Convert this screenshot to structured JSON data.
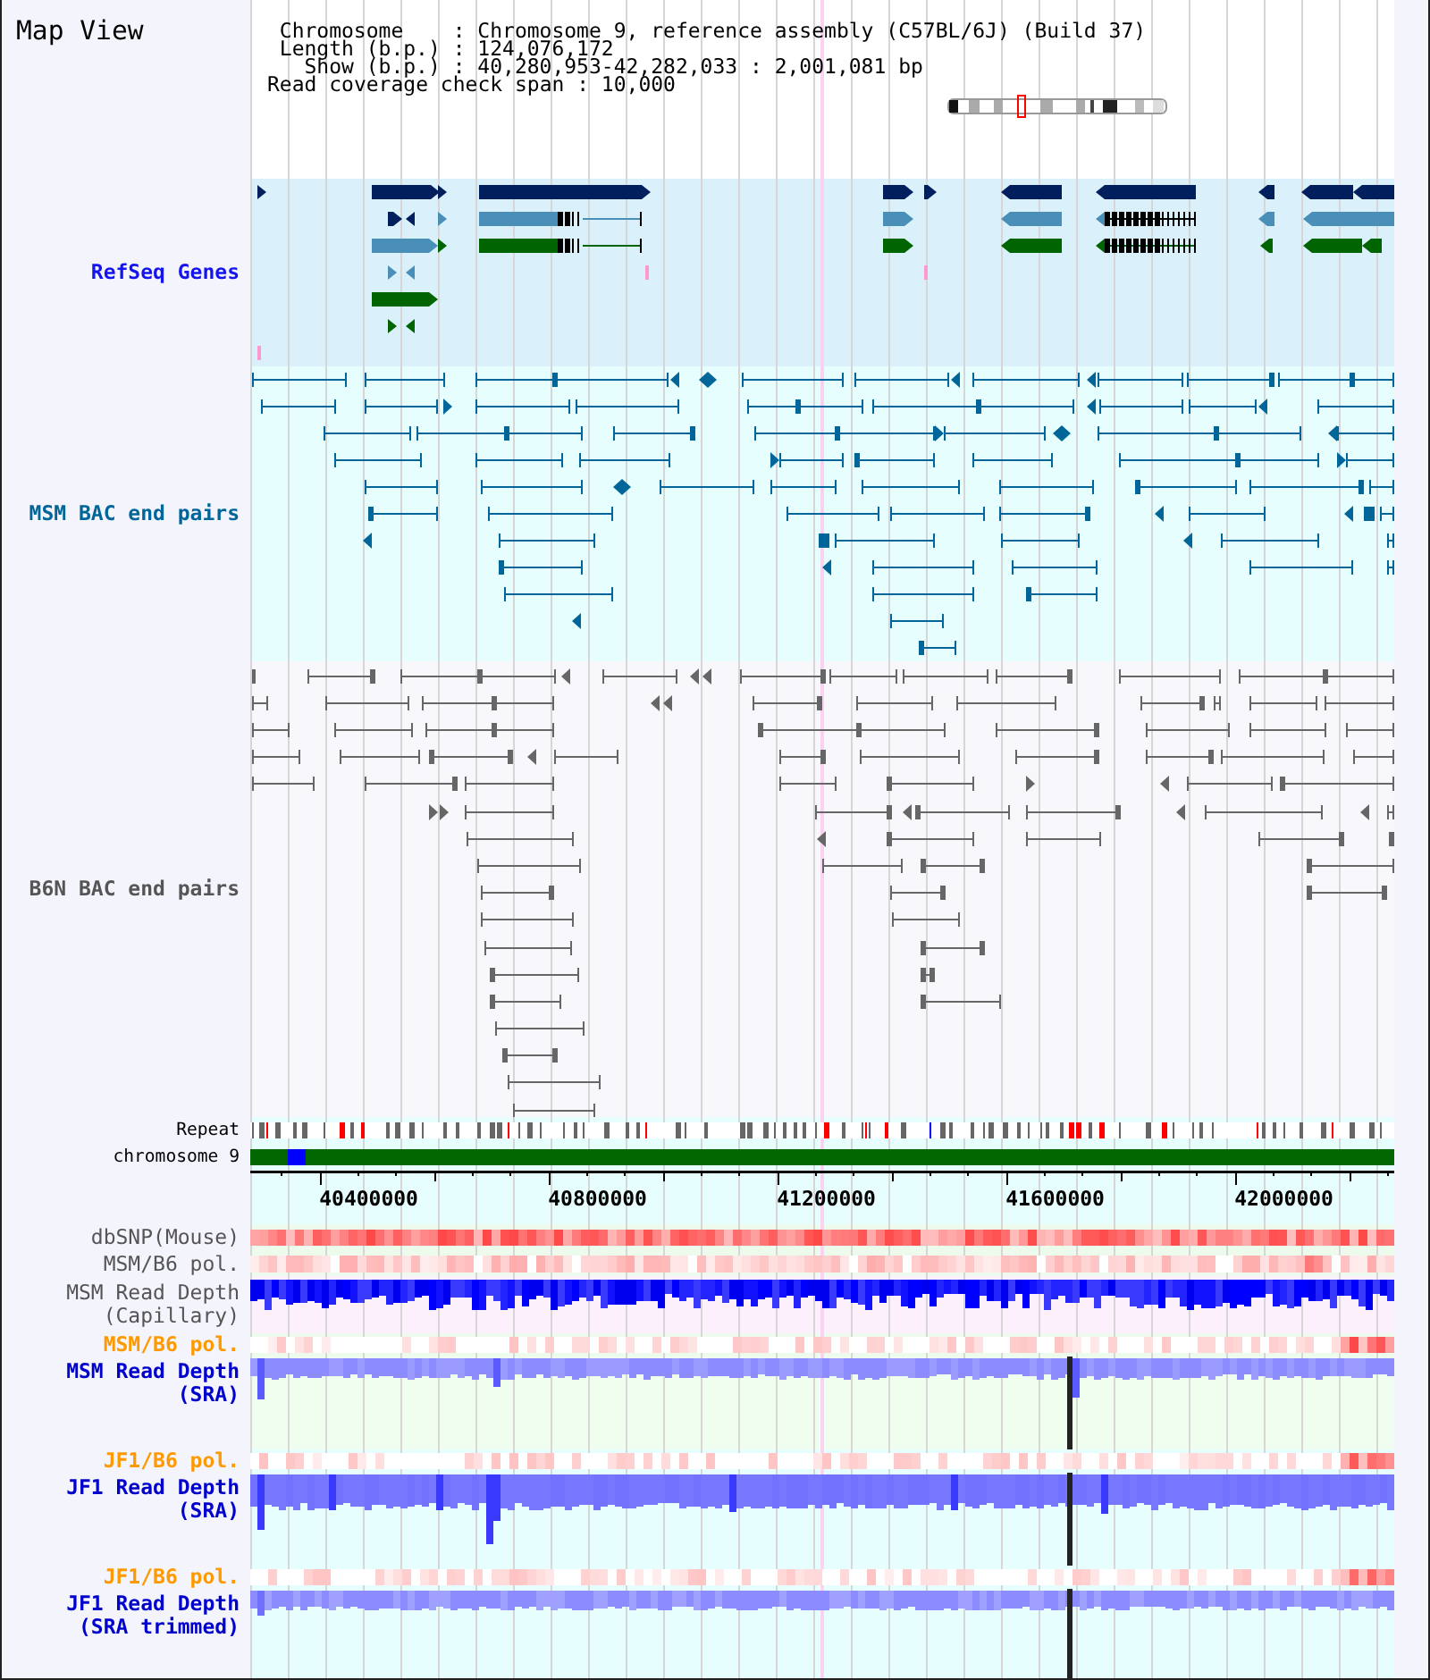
{
  "view": {
    "title": "Map View",
    "info_lines": [
      "Chromosome    : Chromosome 9, reference assembly (C57BL/6J) (Build 37)",
      "Length (b.p.) : 124,076,172",
      "  Show (b.p.) : 40,280,953-42,282,033 : 2,001,081 bp"
    ],
    "coverage_line": "Read coverage check span : 10,000"
  },
  "tracks": [
    {
      "kind": "genes",
      "label": "RefSeq Genes",
      "color": "#1414ee"
    },
    {
      "kind": "bac_pairs",
      "label": "MSM BAC end pairs",
      "color": "#006699"
    },
    {
      "kind": "bac_pairs",
      "label": "B6N BAC end pairs",
      "color": "#555555"
    },
    {
      "kind": "repeat",
      "label": "Repeat",
      "color": "#000000"
    },
    {
      "kind": "chromosome",
      "label": "chromosome 9",
      "color": "#000000"
    },
    {
      "kind": "ruler",
      "ticks": [
        "40400000",
        "40800000",
        "41200000",
        "41600000",
        "42000000"
      ]
    },
    {
      "kind": "heatmap",
      "label": "dbSNP(Mouse)",
      "color": "#555555"
    },
    {
      "kind": "heatmap",
      "label": "MSM/B6 pol.",
      "color": "#555555"
    },
    {
      "kind": "depth",
      "label": "MSM Read Depth (Capillary)",
      "color": "#555555"
    },
    {
      "kind": "heatmap",
      "label": "MSM/B6 pol.",
      "color": "#ff9900"
    },
    {
      "kind": "depth",
      "label": "MSM Read Depth (SRA)",
      "color": "#0000cc"
    },
    {
      "kind": "heatmap",
      "label": "JF1/B6 pol.",
      "color": "#ff9900"
    },
    {
      "kind": "depth",
      "label": "JF1 Read Depth (SRA)",
      "color": "#0000cc"
    },
    {
      "kind": "heatmap",
      "label": "JF1/B6 pol.",
      "color": "#ff9900"
    },
    {
      "kind": "depth",
      "label": "JF1 Read Depth (SRA trimmed)",
      "color": "#0000cc"
    }
  ]
}
